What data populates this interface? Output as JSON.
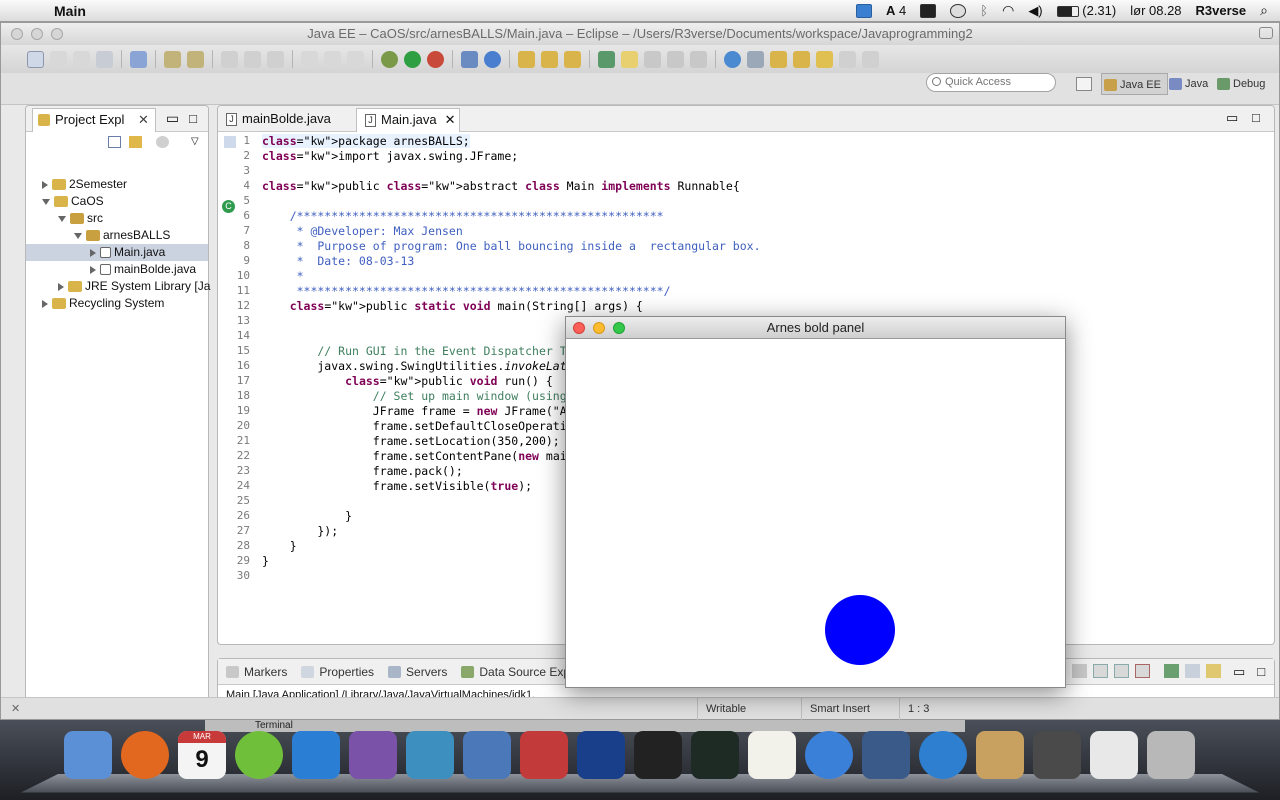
{
  "menubar": {
    "app_name": "Main",
    "battery": "(2.31)",
    "clock": "lør 08.28",
    "user": "R3verse",
    "notification_count": "4"
  },
  "window": {
    "title": "Java EE – CaOS/src/arnesBALLS/Main.java – Eclipse – /Users/R3verse/Documents/workspace/Javaprogramming2"
  },
  "quick_access": {
    "placeholder": "Quick Access"
  },
  "perspectives": [
    "Java EE",
    "Java",
    "Debug"
  ],
  "project_explorer": {
    "tab_label": "Project Expl",
    "tree": [
      {
        "label": "2Semester",
        "expanded": false,
        "depth": 0,
        "icon": "project-folder"
      },
      {
        "label": "CaOS",
        "expanded": true,
        "depth": 0,
        "icon": "project-folder"
      },
      {
        "label": "src",
        "expanded": true,
        "depth": 1,
        "icon": "source-folder"
      },
      {
        "label": "arnesBALLS",
        "expanded": true,
        "depth": 2,
        "icon": "package"
      },
      {
        "label": "Main.java",
        "expanded": false,
        "depth": 3,
        "icon": "java-file",
        "selected": true
      },
      {
        "label": "mainBolde.java",
        "expanded": false,
        "depth": 3,
        "icon": "java-file"
      },
      {
        "label": "JRE System Library [Ja",
        "expanded": false,
        "depth": 1,
        "icon": "library"
      },
      {
        "label": "Recycling System",
        "expanded": false,
        "depth": 0,
        "icon": "project-folder"
      }
    ]
  },
  "editor": {
    "tabs": [
      {
        "label": "mainBolde.java",
        "active": false
      },
      {
        "label": "Main.java",
        "active": true
      }
    ],
    "lines": [
      {
        "n": "1",
        "text": "package arnesBALLS;"
      },
      {
        "n": "2",
        "text": "import javax.swing.JFrame;"
      },
      {
        "n": "3",
        "text": ""
      },
      {
        "n": "4",
        "text": "public abstract class Main implements Runnable{"
      },
      {
        "n": "5",
        "text": ""
      },
      {
        "n": "6",
        "text": "    /*****************************************************"
      },
      {
        "n": "7",
        "text": "     * @Developer: Max Jensen"
      },
      {
        "n": "8",
        "text": "     *  Purpose of program: One ball bouncing inside a  rectangular box."
      },
      {
        "n": "9",
        "text": "     *  Date: 08-03-13"
      },
      {
        "n": "10",
        "text": "     *"
      },
      {
        "n": "11",
        "text": "     *****************************************************/"
      },
      {
        "n": "12",
        "text": "    public static void main(String[] args) {"
      },
      {
        "n": "13",
        "text": ""
      },
      {
        "n": "14",
        "text": ""
      },
      {
        "n": "15",
        "text": "        // Run GUI in the Event Dispatcher T"
      },
      {
        "n": "16",
        "text": "        javax.swing.SwingUtilities.invokeLat"
      },
      {
        "n": "17",
        "text": "            public void run() {"
      },
      {
        "n": "18",
        "text": "                // Set up main window (using"
      },
      {
        "n": "19",
        "text": "                JFrame frame = new JFrame(\"A"
      },
      {
        "n": "20",
        "text": "                frame.setDefaultCloseOperati"
      },
      {
        "n": "21",
        "text": "                frame.setLocation(350,200);"
      },
      {
        "n": "22",
        "text": "                frame.setContentPane(new mai"
      },
      {
        "n": "23",
        "text": "                frame.pack();"
      },
      {
        "n": "24",
        "text": "                frame.setVisible(true);"
      },
      {
        "n": "25",
        "text": ""
      },
      {
        "n": "26",
        "text": "            }"
      },
      {
        "n": "27",
        "text": "        });"
      },
      {
        "n": "28",
        "text": "    }"
      },
      {
        "n": "29",
        "text": "}"
      },
      {
        "n": "30",
        "text": ""
      }
    ]
  },
  "bottom_panel": {
    "tabs": [
      "Markers",
      "Properties",
      "Servers",
      "Data Source Exp"
    ],
    "console_line": "Main [Java Application] /Library/Java/JavaVirtualMachines/jdk1."
  },
  "statusbar": {
    "writable": "Writable",
    "insert_mode": "Smart Insert",
    "position": "1 : 3"
  },
  "java_window": {
    "title": "Arnes bold panel",
    "ball_color": "#0000ff"
  },
  "dock": {
    "terminal_label": "Terminal",
    "calendar_month": "MAR",
    "calendar_day": "9",
    "items": [
      "finder",
      "firefox",
      "ical",
      "spotify",
      "word",
      "eclipse",
      "mysql-workbench",
      "xcode",
      "app",
      "photoshop",
      "terminal",
      "activity-monitor",
      "textedit",
      "itunes",
      "virtualbox",
      "safari",
      "preview",
      "screen-sharing",
      "java",
      "trash"
    ]
  }
}
